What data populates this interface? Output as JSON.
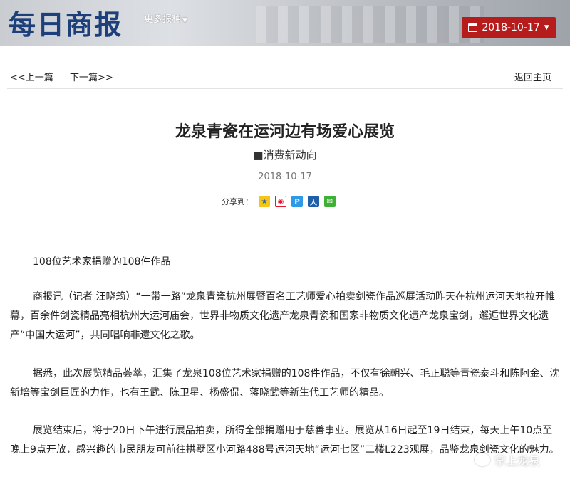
{
  "header": {
    "logo": "每日商报",
    "more_papers": "更多报种",
    "date": "2018-10-17"
  },
  "nav": {
    "prev": "<<上一篇",
    "next": "下一篇>>",
    "home": "返回主页"
  },
  "article": {
    "title": "龙泉青瓷在运河边有场爱心展览",
    "subtitle": "■消费新动向",
    "date": "2018-10-17",
    "share_label": "分享到：",
    "share_icons": [
      "qzone-icon",
      "weibo-icon",
      "tencent-weibo-icon",
      "renren-icon",
      "wechat-icon"
    ],
    "paragraphs": [
      "108位艺术家捐赠的108件作品",
      "商报讯（记者 汪晓筠）“一带一路”龙泉青瓷杭州展暨百名工艺师爱心拍卖剑瓷作品巡展活动昨天在杭州运河天地拉开帷幕，百余件剑瓷精品亮相杭州大运河庙会，世界非物质文化遗产龙泉青瓷和国家非物质文化遗产龙泉宝剑，邂逅世界文化遗产“中国大运河”，共同唱响非遗文化之歌。",
      "据悉，此次展览精品荟萃，汇集了龙泉108位艺术家捐赠的108件作品，不仅有徐朝兴、毛正聪等青瓷泰斗和陈阿金、沈新培等宝剑巨匠的力作，也有王武、陈卫星、杨盛侃、蒋晓武等新生代工艺师的精品。",
      "展览结束后，将于20日下午进行展品拍卖，所得全部捐赠用于慈善事业。展览从16日起至19日结束，每天上午10点至晚上9点开放，感兴趣的市民朋友可前往拱墅区小河路488号运河天地“运河七区”二楼L223观展，品鉴龙泉剑瓷文化的魅力。"
    ]
  },
  "watermark": "掌上龙泉",
  "colors": {
    "date_button": "#b71c1c",
    "logo": "#1d3f7a"
  }
}
